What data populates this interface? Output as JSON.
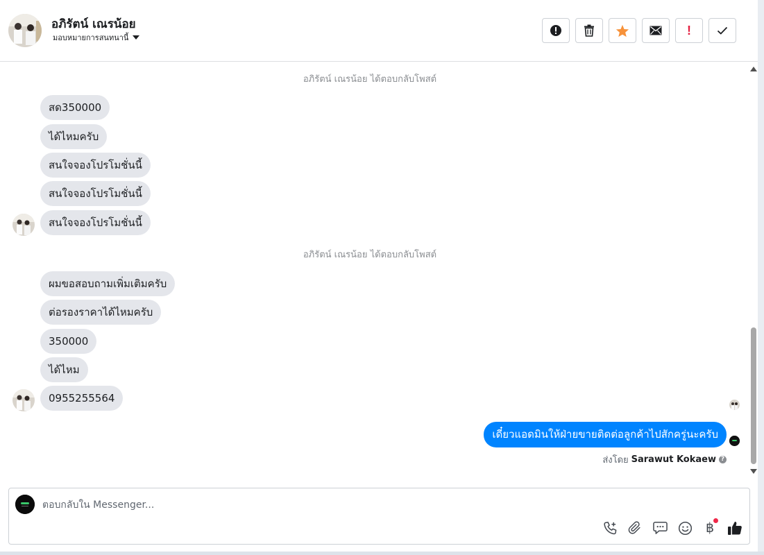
{
  "header": {
    "contact_name": "อภิรัตน์ เณรน้อย",
    "assign_label": "มอบหมายการสนทนานี้"
  },
  "conversation": {
    "system_line_1": "อภิรัตน์ เณรน้อย ได้ตอบกลับโพสต์",
    "group1": [
      "สด350000",
      "ได้ไหมครับ",
      "สนใจจองโปรโมชั่นนี้",
      "สนใจจองโปรโมชั่นนี้",
      "สนใจจองโปรโมชั่นนี้"
    ],
    "system_line_2": "อภิรัตน์ เณรน้อย ได้ตอบกลับโพสต์",
    "group2": [
      "ผมขอสอบถามเพิ่มเติมครับ",
      "ต่อรองราคาได้ไหมครับ",
      "350000",
      "ได้ไหม",
      "0955255564"
    ],
    "outgoing": "เดี๋ยวแอดมินให้ฝ่ายขายติดต่อลูกค้าไปสักครู่นะครับ",
    "sent_by_prefix": "ส่งโดย",
    "sent_by_name": "Sarawut Kokaew"
  },
  "composer": {
    "placeholder": "ตอบกลับใน Messenger..."
  },
  "colors": {
    "accent": "#0084ff",
    "incoming_bubble": "#e4e6eb",
    "star": "#f7923a",
    "flag_red": "#e41e3f"
  },
  "icons": {
    "header_actions": [
      "alert-circle-icon",
      "trash-icon",
      "star-icon",
      "envelope-icon",
      "exclamation-icon",
      "check-icon"
    ],
    "composer_tools": [
      "phone-add-icon",
      "paperclip-icon",
      "chat-bubble-icon",
      "smiley-icon",
      "baht-icon",
      "thumbs-up-icon"
    ]
  }
}
